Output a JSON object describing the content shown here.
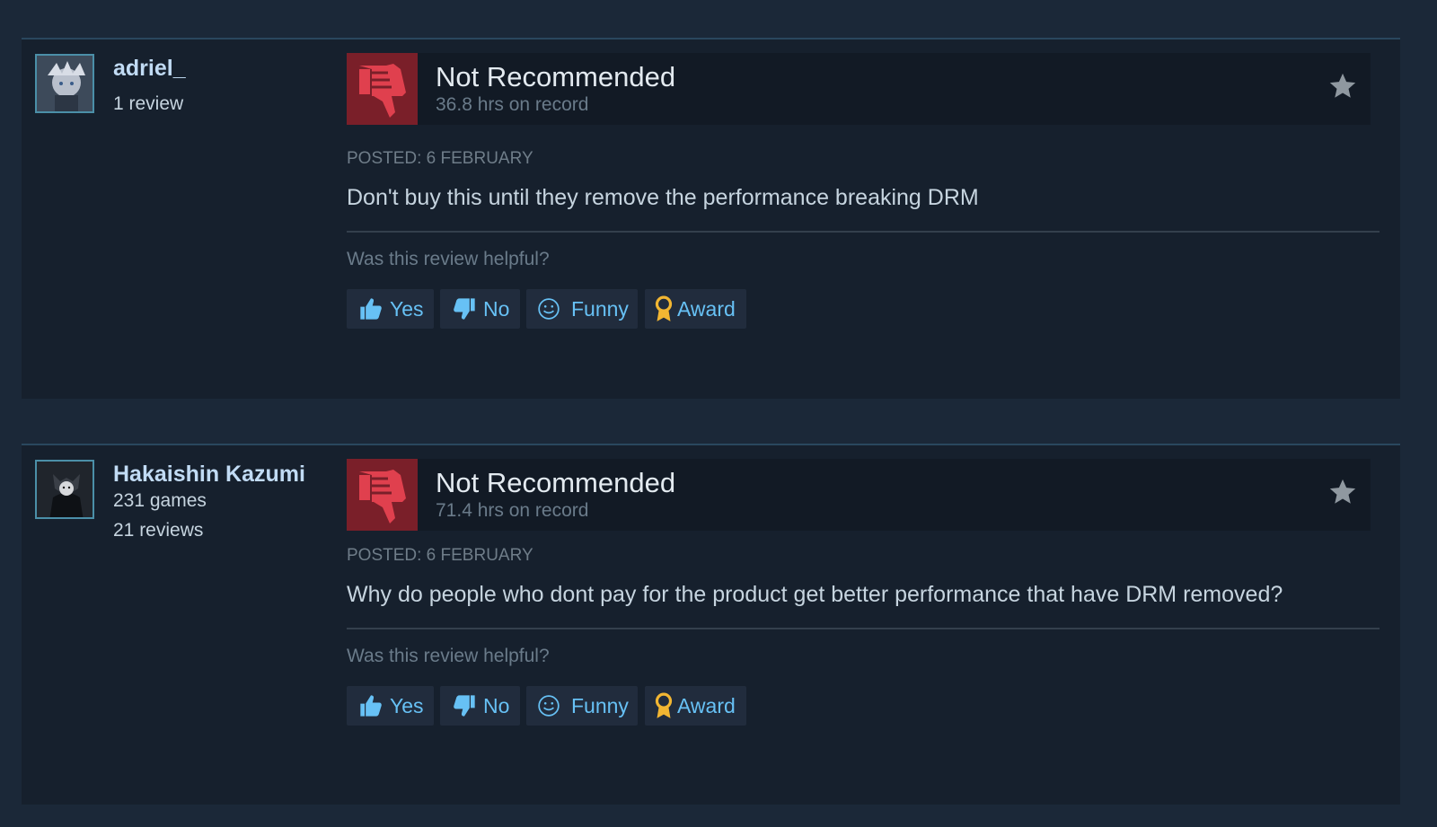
{
  "reviews": [
    {
      "author": {
        "name": "adriel_",
        "meta": [
          "1 review"
        ]
      },
      "verdict": "Not Recommended",
      "hours": "36.8 hrs on record",
      "posted": "POSTED: 6 FEBRUARY",
      "text": "Don't buy this until they remove the performance breaking DRM",
      "helpful_prompt": "Was this review helpful?",
      "buttons": {
        "yes": "Yes",
        "no": "No",
        "funny": "Funny",
        "award": "Award"
      }
    },
    {
      "author": {
        "name": "Hakaishin Kazumi",
        "meta": [
          "231 games",
          "21 reviews"
        ]
      },
      "verdict": "Not Recommended",
      "hours": "71.4 hrs on record",
      "posted": "POSTED: 6 FEBRUARY",
      "text": "Why do people who dont pay for the product get better performance that have DRM removed?",
      "helpful_prompt": "Was this review helpful?",
      "buttons": {
        "yes": "Yes",
        "no": "No",
        "funny": "Funny",
        "award": "Award"
      }
    }
  ],
  "icons": {
    "verdict": "thumbs-down-icon",
    "favorite": "star-icon",
    "yes": "thumbs-up-icon",
    "no": "thumbs-down-icon",
    "funny": "smiley-icon",
    "award": "award-icon"
  },
  "colors": {
    "page_bg": "#1b2838",
    "card_bg": "#16202d",
    "accent_link": "#67c1f5",
    "not_recommended_box": "#7a1f29",
    "thumb_red": "#e0404e",
    "award_gold": "#f2b632"
  }
}
